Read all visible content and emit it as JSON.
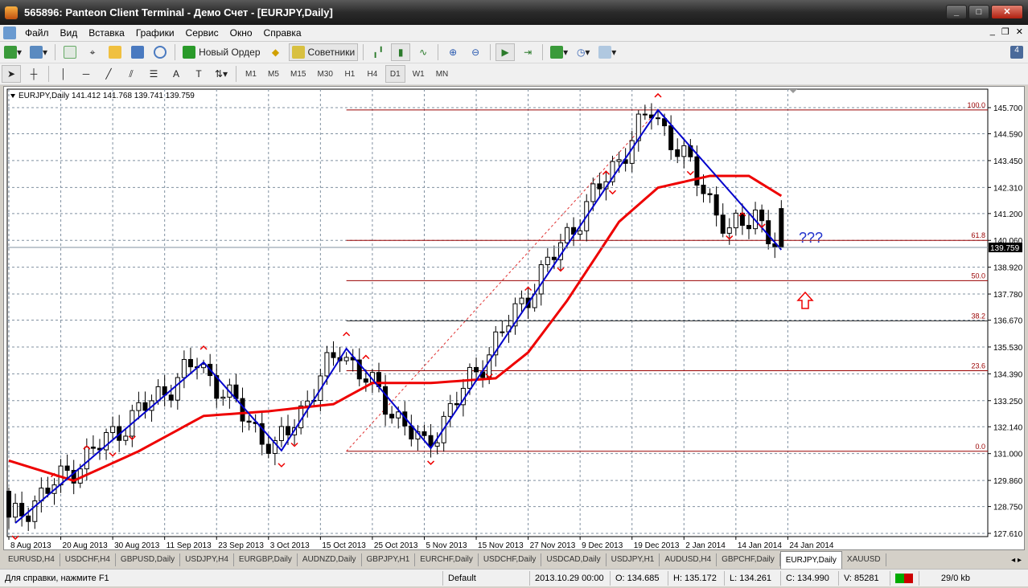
{
  "window": {
    "title": "565896: Panteon Client Terminal - Демо Счет - [EURJPY,Daily]"
  },
  "menu": [
    "Файл",
    "Вид",
    "Вставка",
    "Графики",
    "Сервис",
    "Окно",
    "Справка"
  ],
  "toolbar1": {
    "new_order": "Новый Ордер",
    "experts": "Советники"
  },
  "timeframes": [
    "M1",
    "M5",
    "M15",
    "M30",
    "H1",
    "H4",
    "D1",
    "W1",
    "MN"
  ],
  "active_timeframe": "D1",
  "chart_data": {
    "type": "candlestick",
    "header": "EURJPY,Daily  141.412 141.768 139.741 139.759",
    "symbol": "EURJPY,Daily",
    "ohlc_last": {
      "open": 141.412,
      "high": 141.768,
      "low": 139.741,
      "close": 139.759
    },
    "bid_label": "139.759",
    "ylim": [
      127.61,
      146.1
    ],
    "y_ticks": [
      "145.700",
      "144.590",
      "143.450",
      "142.310",
      "141.200",
      "140.060",
      "138.920",
      "137.780",
      "136.670",
      "135.530",
      "134.390",
      "133.250",
      "132.140",
      "131.000",
      "129.860",
      "128.750",
      "127.610"
    ],
    "x_ticks": [
      {
        "i": 0,
        "label": "8 Aug 2013"
      },
      {
        "i": 8,
        "label": "20 Aug 2013"
      },
      {
        "i": 16,
        "label": "30 Aug 2013"
      },
      {
        "i": 24,
        "label": "11 Sep 2013"
      },
      {
        "i": 32,
        "label": "23 Sep 2013"
      },
      {
        "i": 40,
        "label": "3 Oct 2013"
      },
      {
        "i": 48,
        "label": "15 Oct 2013"
      },
      {
        "i": 56,
        "label": "25 Oct 2013"
      },
      {
        "i": 64,
        "label": "5 Nov 2013"
      },
      {
        "i": 72,
        "label": "15 Nov 2013"
      },
      {
        "i": 80,
        "label": "27 Nov 2013"
      },
      {
        "i": 88,
        "label": "9 Dec 2013"
      },
      {
        "i": 96,
        "label": "19 Dec 2013"
      },
      {
        "i": 104,
        "label": "2 Jan 2014"
      },
      {
        "i": 112,
        "label": "14 Jan 2014"
      },
      {
        "i": 120,
        "label": "24 Jan 2014"
      }
    ],
    "bars": 120,
    "price_pivots": [
      [
        0,
        129.4
      ],
      [
        1,
        128.05
      ],
      [
        30,
        134.88
      ],
      [
        42,
        131.13
      ],
      [
        52,
        135.46
      ],
      [
        65,
        131.23
      ],
      [
        100,
        145.6
      ],
      [
        108,
        142.3
      ],
      [
        112,
        140.3
      ],
      [
        116,
        141.3
      ],
      [
        119,
        139.76
      ]
    ],
    "zigzag": [
      [
        1,
        128.05
      ],
      [
        30,
        134.88
      ],
      [
        42,
        131.13
      ],
      [
        52,
        135.46
      ],
      [
        65,
        131.23
      ],
      [
        100,
        145.6
      ],
      [
        119,
        139.66
      ]
    ],
    "moving_average": [
      [
        0,
        130.7
      ],
      [
        10,
        129.85
      ],
      [
        20,
        131.1
      ],
      [
        30,
        132.6
      ],
      [
        40,
        132.8
      ],
      [
        50,
        133.1
      ],
      [
        56,
        134.0
      ],
      [
        65,
        134.0
      ],
      [
        75,
        134.2
      ],
      [
        80,
        135.3
      ],
      [
        86,
        137.5
      ],
      [
        94,
        140.85
      ],
      [
        100,
        142.3
      ],
      [
        108,
        142.8
      ],
      [
        114,
        142.8
      ],
      [
        119,
        141.95
      ]
    ],
    "fibonacci": {
      "start_bar": 52,
      "from": 131.1,
      "to": 145.6,
      "levels": [
        {
          "label": "100.0",
          "ratio": 1.0
        },
        {
          "label": "61.8",
          "ratio": 0.618
        },
        {
          "label": "50.0",
          "ratio": 0.5
        },
        {
          "label": "38.2",
          "ratio": 0.382
        },
        {
          "label": "23.6",
          "ratio": 0.236
        },
        {
          "label": "0.0",
          "ratio": 0.0
        }
      ]
    },
    "fractals_up": [
      7,
      12,
      30,
      52,
      55,
      80,
      92,
      100,
      113
    ],
    "fractals_down": [
      1,
      16,
      19,
      42,
      44,
      65,
      74,
      85,
      93,
      105,
      111,
      116
    ],
    "annotation": "???",
    "annotation_arrow": "up"
  },
  "colors": {
    "zigzag": "#0000cc",
    "ma": "#ee0000",
    "fib": "#990000",
    "grid": "#8090a0"
  },
  "tabs": [
    "EURUSD,H4",
    "USDCHF,H4",
    "GBPUSD,Daily",
    "USDJPY,H4",
    "EURGBP,Daily",
    "AUDNZD,Daily",
    "GBPJPY,H1",
    "EURCHF,Daily",
    "USDCHF,Daily",
    "USDCAD,Daily",
    "USDJPY,H1",
    "AUDUSD,H4",
    "GBPCHF,Daily",
    "EURJPY,Daily",
    "XAUUSD"
  ],
  "active_tab": "EURJPY,Daily",
  "status": {
    "help": "Для справки, нажмите F1",
    "profile": "Default",
    "datetime": "2013.10.29 00:00",
    "open": "O: 134.685",
    "high": "H: 135.172",
    "low": "L: 134.261",
    "close": "C: 134.990",
    "volume": "V: 85281",
    "traffic": "29/0 kb"
  }
}
